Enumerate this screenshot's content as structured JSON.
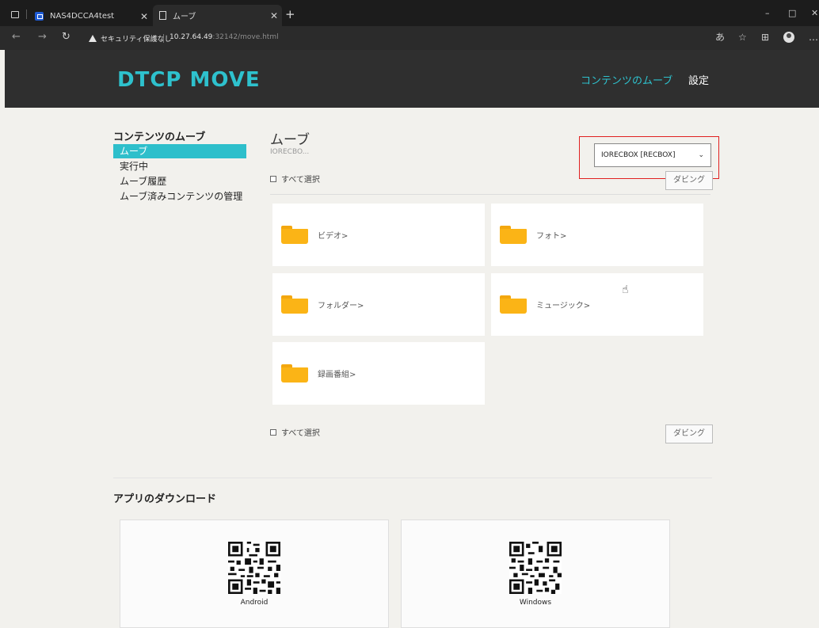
{
  "browser": {
    "tabs": [
      {
        "title": "NAS4DCCA4test",
        "active": false
      },
      {
        "title": "ムーブ",
        "active": true
      }
    ],
    "new_tab": "+",
    "security_label": "セキュリティ保護なし",
    "url_host": "10.27.64.49",
    "url_rest": ":32142/move.html",
    "window_controls": [
      "–",
      "□",
      "✕"
    ]
  },
  "header": {
    "logo": "DTCP MOVE",
    "nav": [
      {
        "label": "コンテンツのムーブ",
        "active": true
      },
      {
        "label": "設定",
        "active": false
      }
    ]
  },
  "sidebar": {
    "title": "コンテンツのムーブ",
    "items": [
      {
        "label": "ムーブ",
        "selected": true
      },
      {
        "label": "実行中",
        "selected": false
      },
      {
        "label": "ムーブ履歴",
        "selected": false
      },
      {
        "label": "ムーブ済みコンテンツの管理",
        "selected": false
      }
    ]
  },
  "main": {
    "title": "ムーブ",
    "device_short": "IORECBO...",
    "device_select": {
      "value": "IORECBOX [RECBOX]"
    },
    "select_all": "すべて選択",
    "dubbing_button": "ダビング",
    "folders": [
      {
        "label": "ビデオ>"
      },
      {
        "label": "フォト>"
      },
      {
        "label": "フォルダー>"
      },
      {
        "label": "ミュージック>"
      },
      {
        "label": "録画番組>"
      }
    ]
  },
  "apps": {
    "title": "アプリのダウンロード",
    "items": [
      {
        "label": "Android"
      },
      {
        "label": "Windows"
      }
    ]
  },
  "colors": {
    "accent": "#2ec1cd",
    "header_bg": "#2f2f2f",
    "folder": "#fbb416",
    "highlight_box": "#e02020"
  }
}
